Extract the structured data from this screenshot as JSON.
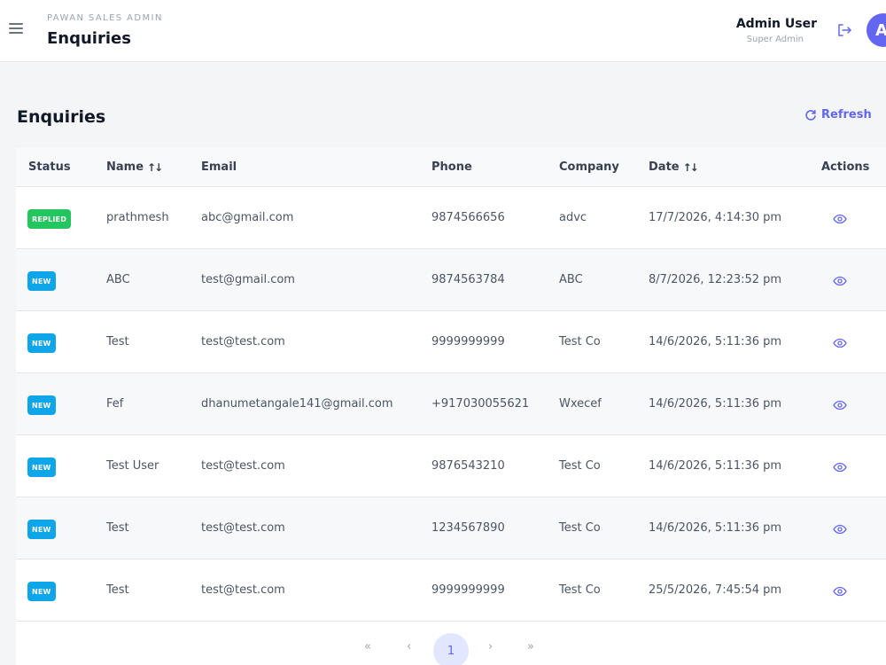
{
  "header": {
    "brand": "PAWAN SALES ADMIN",
    "title": "Enquiries",
    "user_name": "Admin User",
    "user_role": "Super Admin",
    "avatar_initial": "A"
  },
  "section": {
    "title": "Enquiries",
    "refresh_label": "Refresh"
  },
  "table": {
    "columns": [
      "Status",
      "Name",
      "Email",
      "Phone",
      "Company",
      "Date",
      "Actions"
    ],
    "rows": [
      {
        "status": "REPLIED",
        "name": "prathmesh",
        "email": "abc@gmail.com",
        "phone": "9874566656",
        "company": "advc",
        "date": "17/7/2026, 4:14:30 pm"
      },
      {
        "status": "NEW",
        "name": "ABC",
        "email": "test@gmail.com",
        "phone": "9874563784",
        "company": "ABC",
        "date": "8/7/2026, 12:23:52 pm"
      },
      {
        "status": "NEW",
        "name": "Test",
        "email": "test@test.com",
        "phone": "9999999999",
        "company": "Test Co",
        "date": "14/6/2026, 5:11:36 pm"
      },
      {
        "status": "NEW",
        "name": "Fef",
        "email": "dhanumetangale141@gmail.com",
        "phone": "+917030055621",
        "company": "Wxecef",
        "date": "14/6/2026, 5:11:36 pm"
      },
      {
        "status": "NEW",
        "name": "Test User",
        "email": "test@test.com",
        "phone": "9876543210",
        "company": "Test Co",
        "date": "14/6/2026, 5:11:36 pm"
      },
      {
        "status": "NEW",
        "name": "Test",
        "email": "test@test.com",
        "phone": "1234567890",
        "company": "Test Co",
        "date": "14/6/2026, 5:11:36 pm"
      },
      {
        "status": "NEW",
        "name": "Test",
        "email": "test@test.com",
        "phone": "9999999999",
        "company": "Test Co",
        "date": "25/5/2026, 7:45:54 pm"
      }
    ]
  },
  "pagination": {
    "first": "«",
    "prev": "‹",
    "current": "1",
    "next": "›",
    "last": "»"
  },
  "colors": {
    "accent": "#6366f1",
    "replied": "#22c55e",
    "new": "#0ea5e9"
  },
  "icons": [
    "menu-icon",
    "logout-icon",
    "refresh-icon",
    "eye-icon"
  ]
}
